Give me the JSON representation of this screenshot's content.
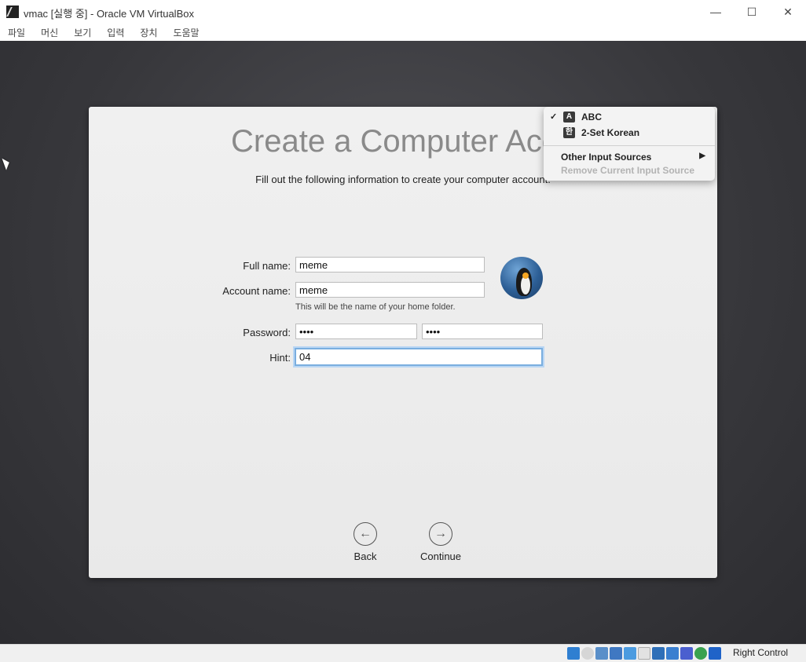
{
  "window": {
    "title": "vmac [실행 중] - Oracle VM VirtualBox",
    "minimize": "—",
    "maximize": "☐",
    "close": "✕"
  },
  "menu": [
    "파일",
    "머신",
    "보기",
    "입력",
    "장치",
    "도움말"
  ],
  "setup": {
    "title": "Create a Computer Acco",
    "subtitle": "Fill out the following information to create your computer account.",
    "full_name_label": "Full name:",
    "full_name_value": "meme",
    "account_name_label": "Account name:",
    "account_name_value": "meme",
    "account_note": "This will be the name of your home folder.",
    "password_label": "Password:",
    "password_value": "••••",
    "verify_value": "••••",
    "hint_label": "Hint:",
    "hint_value": "04",
    "back_label": "Back",
    "continue_label": "Continue"
  },
  "input_menu": {
    "abc_check": "✓",
    "abc_icon": "A",
    "abc_label": "ABC",
    "korean_icon": "한",
    "korean_label": "2-Set Korean",
    "other_label": "Other Input Sources",
    "other_arrow": "▶",
    "remove_label": "Remove Current Input Source"
  },
  "status": {
    "host_key": "Right Control"
  },
  "colors": {
    "focus_ring": "#7aaedf",
    "vm_background": "#37373b"
  }
}
